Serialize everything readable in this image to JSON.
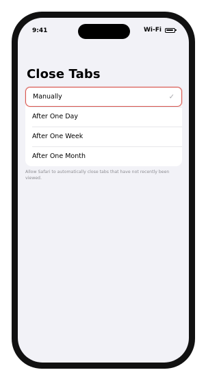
{
  "status_bar": {
    "time": "9:41",
    "network": "Wi-Fi",
    "battery_level": 0.8
  },
  "page": {
    "title": "Close Tabs"
  },
  "options": [
    {
      "label": "Manually",
      "selected": true
    },
    {
      "label": "After One Day",
      "selected": false
    },
    {
      "label": "After One Week",
      "selected": false
    },
    {
      "label": "After One Month",
      "selected": false
    }
  ],
  "checkmark_glyph": "✓",
  "footer": {
    "text": "Allow Safari to automatically close tabs that have not recently been viewed."
  },
  "colors": {
    "selected_border": "#d9564f",
    "background": "#f2f2f7",
    "footer_text": "#8e8e93"
  }
}
